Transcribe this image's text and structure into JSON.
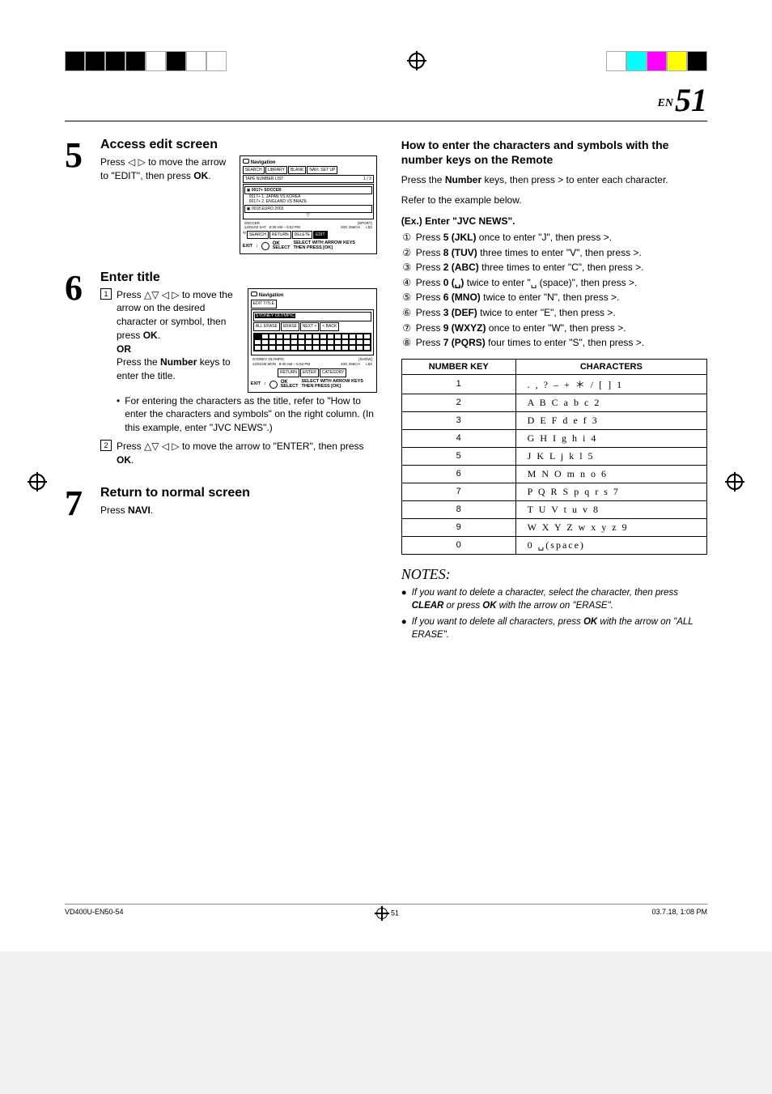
{
  "page": {
    "en_label": "EN",
    "number": "51"
  },
  "left": {
    "step5": {
      "num": "5",
      "title": "Access edit screen",
      "text": "Press ◁ ▷ to move the arrow to \"EDIT\", then press OK."
    },
    "step6": {
      "num": "6",
      "title": "Enter title",
      "sub1_num": "1",
      "sub1": "Press △▽ ◁ ▷ to move the arrow on the desired character or symbol, then press OK.",
      "or": "OR",
      "or_text": "Press the Number keys to enter the title.",
      "bullet": "For entering the characters as the title, refer to \"How to enter the characters and symbols\" on the right column. (In this example, enter \"JVC NEWS\".)",
      "sub2_num": "2",
      "sub2": "Press △▽ ◁ ▷ to move the arrow to \"ENTER\", then press OK."
    },
    "step7": {
      "num": "7",
      "title": "Return to normal screen",
      "text": "Press NAVI."
    },
    "scratch1": {
      "nav": "Navigation",
      "tabs": [
        "SEARCH",
        "LIBRARY",
        "BLANK",
        "NAVI. SET UP"
      ],
      "header": "TAPE NUMBER LIST",
      "header_right": "1 / 3",
      "rows": [
        "0017+  SOCCER",
        "0017+  1. JAPAN VS KOREA",
        "0017+  2. ENGLAND VS BRAZIL",
        "0018   EURO 2003"
      ],
      "meta_left": "SOCCER\n12/01/02 SAT   8:30 AM – 5:52 PM",
      "meta_right": "[SPORT]\n20G 256CH      L53",
      "buttons": [
        "SEARCH",
        "RETURN",
        "DELETE",
        "EDIT"
      ],
      "exit": "EXIT",
      "ok": "OK",
      "select": "SELECT",
      "help1": "SELECT WITH ARROW KEYS",
      "help2": "THEN PRESS [OK]"
    },
    "scratch2": {
      "nav": "Navigation",
      "tab": "EDIT TITLE",
      "field": "SYDNEY OLYMPIC",
      "btns": [
        "ALL ERASE",
        "ERASE",
        "NEXT >",
        "< BACK"
      ],
      "meta_left": "SYDNEY OLYMPIC\n12/01/00 MON   8:30 AM – 5:53 PM",
      "meta_right": "[SHOW]\n20G 256CH      L53",
      "buttons": [
        "RETURN",
        "ENTER",
        "CATEGORY"
      ],
      "exit": "EXIT",
      "ok": "OK",
      "select": "SELECT",
      "help1": "SELECT WITH ARROW KEYS",
      "help2": "THEN PRESS [OK]"
    }
  },
  "right": {
    "heading": "How to enter the characters and symbols with the number keys on the Remote",
    "intro1": "Press the Number keys, then press > to enter each character.",
    "intro2": "Refer to the example below.",
    "example_title": "(Ex.) Enter \"JVC NEWS\".",
    "steps": [
      "Press 5 (JKL) once to enter \"J\", then press >.",
      "Press 8 (TUV) three times to enter \"V\", then press >.",
      "Press 2 (ABC) three times to enter \"C\", then press >.",
      "Press 0 (␣) twice to enter \"␣ (space)\", then press >.",
      "Press 6 (MNO) twice to enter \"N\", then press >.",
      "Press 3 (DEF) twice to enter \"E\", then press >.",
      "Press 9 (WXYZ) once to enter \"W\", then press >.",
      "Press 7 (PQRS) four times to enter \"S\", then press >."
    ],
    "table": {
      "head_key": "NUMBER KEY",
      "head_chars": "CHARACTERS",
      "rows": [
        {
          "k": "1",
          "c": ". , ? – + ＊ / [ ] 1"
        },
        {
          "k": "2",
          "c": "A B C a b c 2"
        },
        {
          "k": "3",
          "c": "D E F d e f 3"
        },
        {
          "k": "4",
          "c": "G H I g h i 4"
        },
        {
          "k": "5",
          "c": "J K L j k l 5"
        },
        {
          "k": "6",
          "c": "M N O m n o 6"
        },
        {
          "k": "7",
          "c": "P Q R S p q r s 7"
        },
        {
          "k": "8",
          "c": "T U V t u v 8"
        },
        {
          "k": "9",
          "c": "W X Y Z w x y z 9"
        },
        {
          "k": "0",
          "c": "0 ␣(space)"
        }
      ]
    },
    "notes_title": "NOTES:",
    "notes": [
      "If you want to delete a character, select the character, then press CLEAR or press OK with the arrow on \"ERASE\".",
      "If you want to delete all characters, press OK with the arrow on \"ALL ERASE\"."
    ]
  },
  "footer": {
    "file": "VD400U-EN50-54",
    "page": "51",
    "timestamp": "03.7.18, 1:08 PM"
  }
}
